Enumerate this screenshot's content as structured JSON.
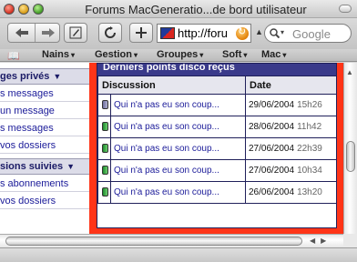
{
  "window": {
    "title": "Forums MacGeneratio...de bord utilisateur"
  },
  "toolbar": {
    "url": "http://foru",
    "search_placeholder": "Google"
  },
  "bookmarks": [
    {
      "label": "Nains"
    },
    {
      "label": "Gestion"
    },
    {
      "label": "Groupes"
    },
    {
      "label": "Soft"
    },
    {
      "label": "Mac"
    }
  ],
  "sidebar": {
    "sections": [
      {
        "title": "ges privés",
        "items": [
          "s messages",
          "un message",
          "s messages",
          "vos dossiers"
        ]
      },
      {
        "title": "sions suivies",
        "items": [
          "s abonnements",
          "vos dossiers"
        ]
      }
    ]
  },
  "panel": {
    "title": "Derniers points disco reçus",
    "columns": [
      "Discussion",
      "Date"
    ],
    "rows": [
      {
        "topic": "Qui n'a pas eu son coup...",
        "date": "29/06/2004",
        "time": "15h26",
        "status": "read"
      },
      {
        "topic": "Qui n'a pas eu son coup...",
        "date": "28/06/2004",
        "time": "11h42",
        "status": "new"
      },
      {
        "topic": "Qui n'a pas eu son coup...",
        "date": "27/06/2004",
        "time": "22h39",
        "status": "new"
      },
      {
        "topic": "Qui n'a pas eu son coup...",
        "date": "27/06/2004",
        "time": "10h34",
        "status": "new"
      },
      {
        "topic": "Qui n'a pas eu son coup...",
        "date": "26/06/2004",
        "time": "13h20",
        "status": "new"
      }
    ]
  },
  "colors": {
    "page_border": "#ff3518",
    "panel_header": "#3a3a8a",
    "link": "#1b1b99"
  }
}
